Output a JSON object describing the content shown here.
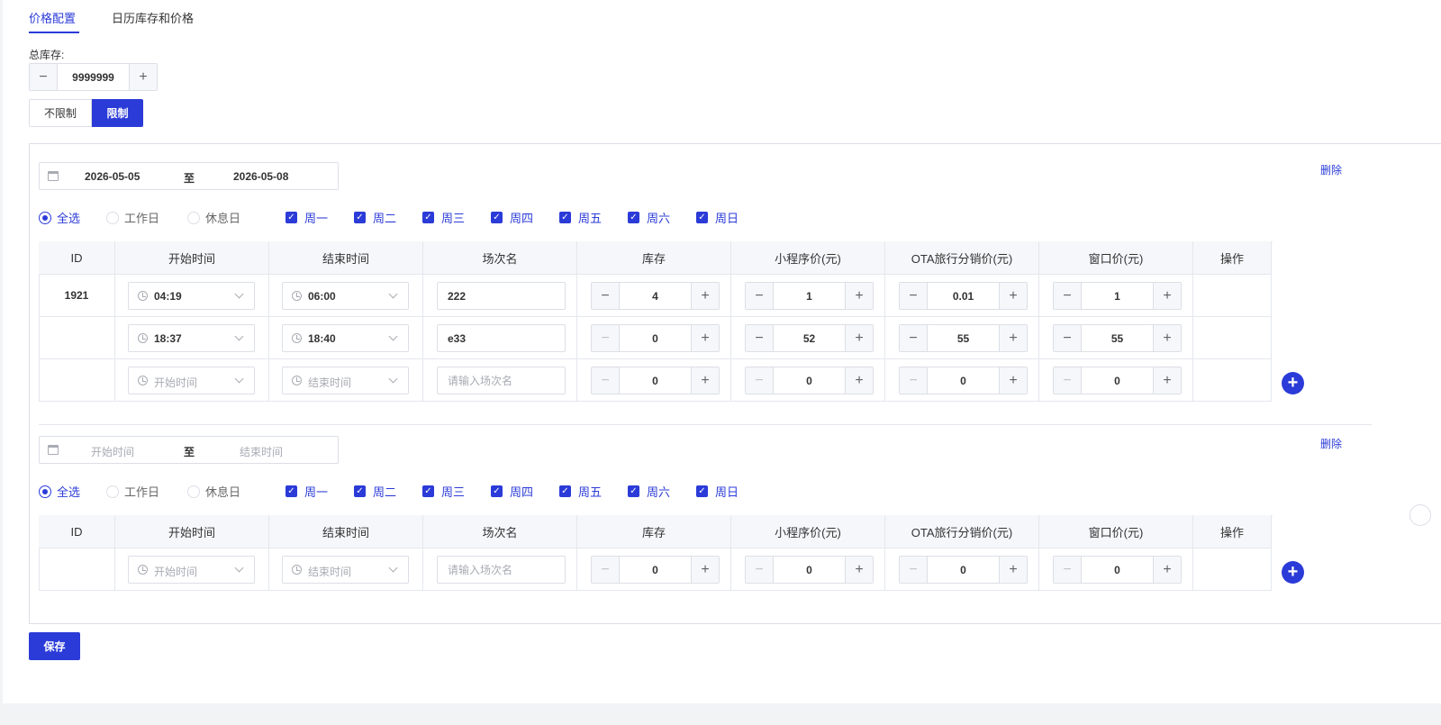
{
  "tabs": [
    {
      "label": "价格配置",
      "active": true
    },
    {
      "label": "日历库存和价格",
      "active": false
    }
  ],
  "total_stock": {
    "label": "总库存:",
    "value": "9999999",
    "minus": "−",
    "plus": "+"
  },
  "limit_toggle": {
    "options": [
      "不限制",
      "限制"
    ],
    "selected": "限制"
  },
  "week_options": {
    "radios": [
      "全选",
      "工作日",
      "休息日"
    ],
    "days": [
      "周一",
      "周二",
      "周三",
      "周四",
      "周五",
      "周六",
      "周日"
    ]
  },
  "table_headers": [
    "ID",
    "开始时间",
    "结束时间",
    "场次名",
    "库存",
    "小程序价(元)",
    "OTA旅行分销价(元)",
    "窗口价(元)",
    "操作"
  ],
  "placeholders": {
    "start_time": "开始时间",
    "end_time": "结束时间",
    "session_name": "请输入场次名"
  },
  "blocks": [
    {
      "date_start": "2026-05-05",
      "date_sep": "至",
      "date_end": "2026-05-08",
      "delete_label": "删除",
      "selected_radio": "全选",
      "rows": [
        {
          "id": "1921",
          "start": "04:19",
          "end": "06:00",
          "name": "222",
          "stock": "4",
          "mini_price": "1",
          "ota_price": "0.01",
          "window_price": "1"
        },
        {
          "id": "",
          "start": "18:37",
          "end": "18:40",
          "name": "e33",
          "stock": "0",
          "mini_price": "52",
          "ota_price": "55",
          "window_price": "55"
        },
        {
          "id": "",
          "start": "开始时间",
          "end": "结束时间",
          "name": "请输入场次名",
          "stock": "0",
          "mini_price": "0",
          "ota_price": "0",
          "window_price": "0"
        }
      ]
    },
    {
      "date_start": "开始时间",
      "date_sep": "至",
      "date_end": "结束时间",
      "delete_label": "删除",
      "selected_radio": "全选",
      "rows": [
        {
          "id": "",
          "start": "开始时间",
          "end": "结束时间",
          "name": "请输入场次名",
          "stock": "0",
          "mini_price": "0",
          "ota_price": "0",
          "window_price": "0"
        }
      ]
    }
  ],
  "save_label": "保存",
  "icons": {
    "add": "plus-circle-icon",
    "calendar": "calendar-icon",
    "clock": "clock-icon",
    "chevron": "chevron-down-icon",
    "check": "✓"
  },
  "colors": {
    "accent": "#2b3bd8",
    "border": "#dcdfe6",
    "header_bg": "#f5f7fa"
  }
}
